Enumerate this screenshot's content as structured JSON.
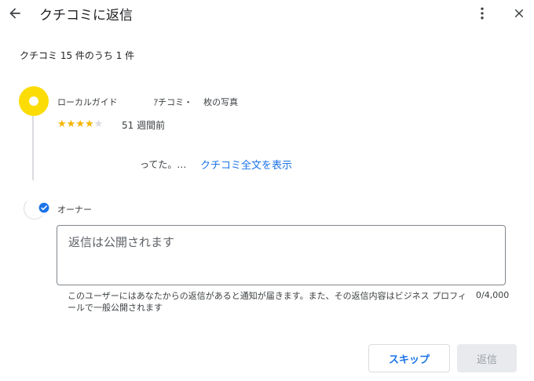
{
  "header": {
    "back_icon": "arrow-back-icon",
    "title": "クチコミに返信",
    "more_icon": "more-vert-icon",
    "close_icon": "close-icon"
  },
  "review_counter": "クチコミ 15 件のうち 1 件",
  "review": {
    "reviewer_label": "ローカルガイド",
    "reviewer_stats_1": "ｱチコミ・",
    "reviewer_stats_2": "枚の写真",
    "rating": 4,
    "rating_max": 5,
    "star_color": "#f4b400",
    "avatar_color": "#fbdc04",
    "time_ago": "51 週間前",
    "snippet": "ってた。…",
    "read_more": "クチコミ全文を表示"
  },
  "owner": {
    "label": "オーナー",
    "verified_icon": "verified-check-icon",
    "verified_color": "#1a73e8"
  },
  "reply": {
    "placeholder": "返信は公開されます",
    "value": "",
    "helper_text": "このユーザーにはあなたからの返信があると通知が届きます。また、その返信内容はビジネス プロフィールで一般公開されます",
    "char_count": "0/4,000"
  },
  "actions": {
    "skip_label": "スキップ",
    "submit_label": "返信"
  }
}
